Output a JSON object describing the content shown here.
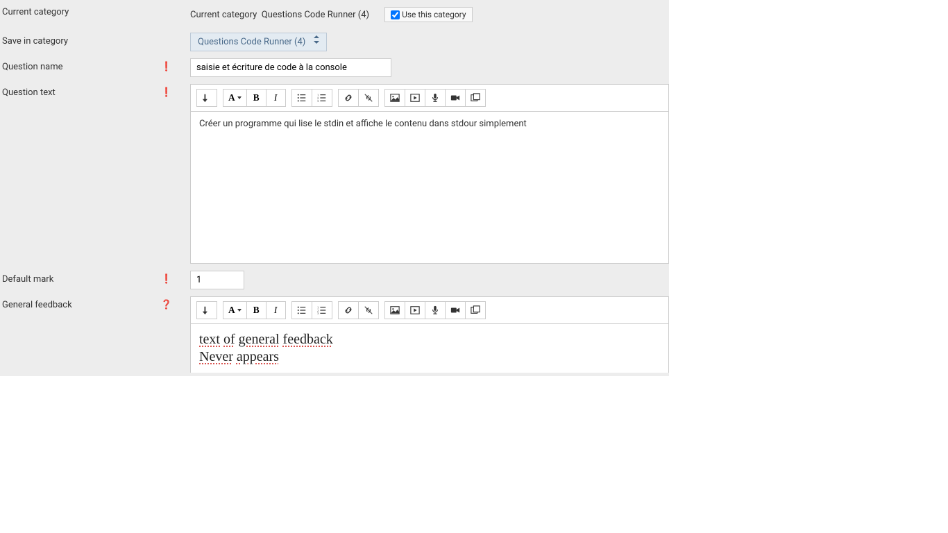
{
  "labels": {
    "current_category": "Current category",
    "save_in_category": "Save in category",
    "question_name": "Question name",
    "question_text": "Question text",
    "default_mark": "Default mark",
    "general_feedback": "General feedback"
  },
  "current_category_row": {
    "prefix": "Current category",
    "value": "Questions Code Runner (4)",
    "use_this_label": "Use this category",
    "checked": true
  },
  "save_in_category_select": "Questions Code Runner (4)",
  "question_name_value": "saisie et écriture de code à la console",
  "question_text_content": "Créer un programme qui lise le stdin et affiche le contenu dans stdour simplement",
  "default_mark_value": "1",
  "general_feedback_content": {
    "line1": {
      "w1": "text",
      "w2": "of",
      "w3": "general",
      "w4": "feedback"
    },
    "line2": {
      "w1": "Never",
      "w2": "appears"
    }
  },
  "icons": {
    "required_glyph": "❗",
    "help_glyph": "❓"
  }
}
